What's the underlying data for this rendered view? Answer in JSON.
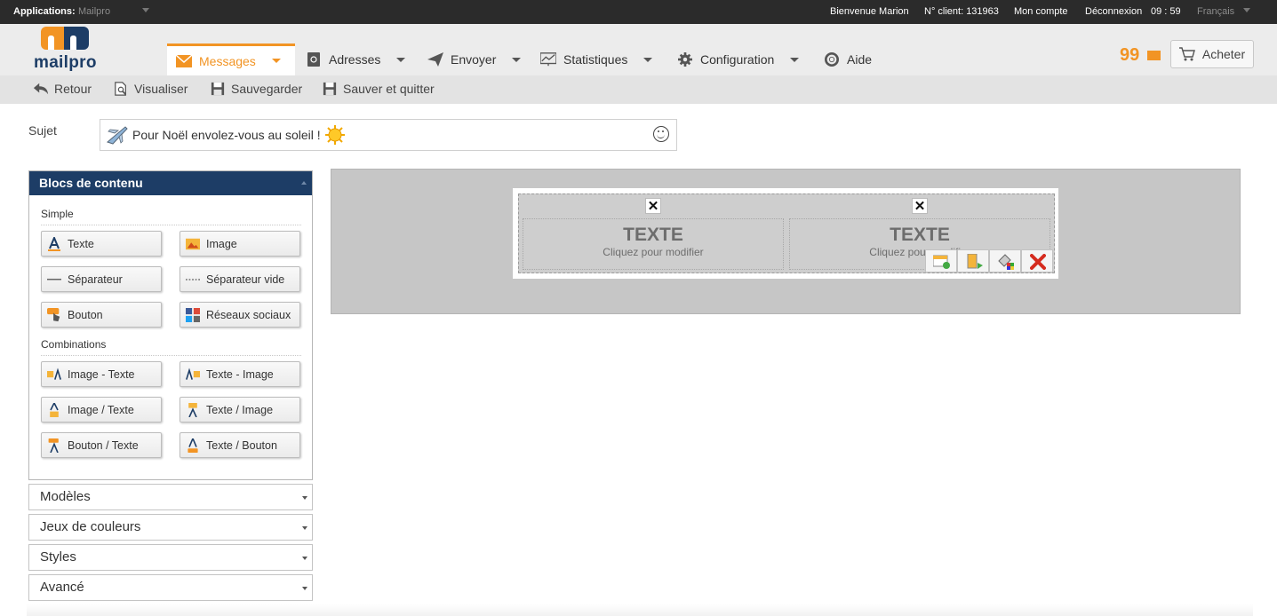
{
  "topbar": {
    "apps_label": "Applications:",
    "apps_value": "Mailpro",
    "welcome": "Bienvenue Marion",
    "client": "N° client: 131963",
    "account": "Mon compte",
    "logout": "Déconnexion",
    "time": "09 : 59",
    "language": "Français"
  },
  "logo": {
    "text": "mailpro"
  },
  "nav": {
    "items": [
      {
        "label": "Messages",
        "icon": "envelope-icon"
      },
      {
        "label": "Adresses",
        "icon": "address-book-icon"
      },
      {
        "label": "Envoyer",
        "icon": "paper-plane-icon"
      },
      {
        "label": "Statistiques",
        "icon": "chart-icon"
      },
      {
        "label": "Configuration",
        "icon": "gear-icon"
      },
      {
        "label": "Aide",
        "icon": "lifebuoy-icon"
      }
    ],
    "credits": "99",
    "buy_label": "Acheter"
  },
  "toolbar": {
    "back": "Retour",
    "preview": "Visualiser",
    "save": "Sauvegarder",
    "save_quit": "Sauver et quitter"
  },
  "subject": {
    "label": "Sujet",
    "value": "Pour Noël envolez-vous au soleil !"
  },
  "panel": {
    "title": "Blocs de contenu",
    "groups": [
      {
        "title": "Simple",
        "blocks": [
          "Texte",
          "Image",
          "Séparateur",
          "Séparateur vide",
          "Bouton",
          "Réseaux sociaux"
        ]
      },
      {
        "title": "Combinations",
        "blocks": [
          "Image - Texte",
          "Texte - Image",
          "Image / Texte",
          "Texte / Image",
          "Bouton / Texte",
          "Texte / Bouton"
        ]
      }
    ],
    "accordions": [
      "Modèles",
      "Jeux de couleurs",
      "Styles",
      "Avancé"
    ]
  },
  "editor": {
    "cells": [
      {
        "title": "TEXTE",
        "hint": "Cliquez pour modifier"
      },
      {
        "title": "TEXTE",
        "hint": "Cliquez pour modifier"
      }
    ],
    "close_glyph": "✕"
  },
  "colors": {
    "accent": "#f29424",
    "brand_navy": "#1d3d66",
    "topbar": "#2b2b2b"
  }
}
